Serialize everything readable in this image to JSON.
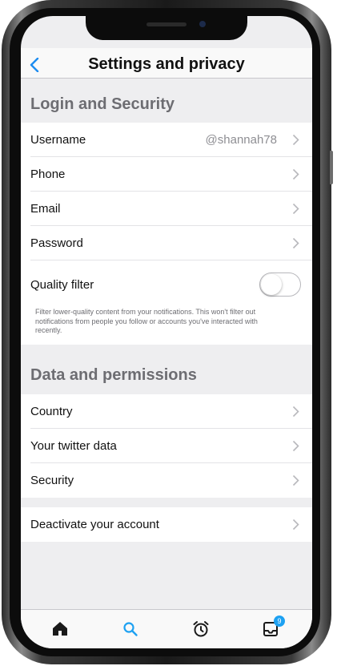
{
  "header": {
    "title": "Settings and privacy"
  },
  "sections": [
    {
      "title": "Login and Security",
      "rows": [
        {
          "label": "Username",
          "value": "@shannah78"
        },
        {
          "label": "Phone"
        },
        {
          "label": "Email"
        },
        {
          "label": "Password"
        }
      ],
      "quality_filter": {
        "label": "Quality filter",
        "enabled": false,
        "description": "Filter lower-quality content from your notifications. This won't filter out notifications from people you follow or accounts you've interacted with recently."
      }
    },
    {
      "title": "Data and permissions",
      "rows": [
        {
          "label": "Country"
        },
        {
          "label": "Your twitter data"
        },
        {
          "label": "Security"
        }
      ]
    }
  ],
  "deactivate": {
    "label": "Deactivate your account"
  },
  "tabbar": {
    "tabs": [
      {
        "icon": "home-icon",
        "active": false
      },
      {
        "icon": "search-icon",
        "active": true
      },
      {
        "icon": "alarm-clock-icon",
        "active": false
      },
      {
        "icon": "inbox-icon",
        "active": false
      }
    ],
    "inbox_badge": "9"
  },
  "colors": {
    "accent": "#1da1f2",
    "nav_tint": "#1d8cf0"
  }
}
